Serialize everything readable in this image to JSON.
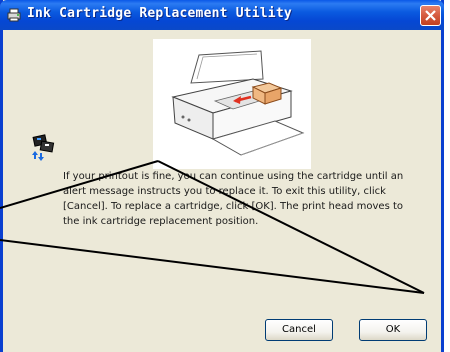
{
  "window": {
    "title": "Ink Cartridge Replacement Utility"
  },
  "message": {
    "body": "If your printout is fine, you can continue using the cartridge until an alert message instructs you to replace it. To exit this utility, click [Cancel]. To replace a cartridge, click [OK]. The print head moves to the ink cartridge replacement position."
  },
  "buttons": {
    "cancel_label": "Cancel",
    "ok_label": "OK"
  },
  "icons": {
    "title": "printer-app-icon",
    "close": "close-icon",
    "cartridge": "ink-cartridge-icon",
    "illustration": "printer-cartridge-illustration"
  },
  "colors": {
    "titlebar": "#0a58e8",
    "close_button": "#d55b3f",
    "dialog_background": "#ece9d8",
    "cartridge_arrow": "#e03020"
  }
}
